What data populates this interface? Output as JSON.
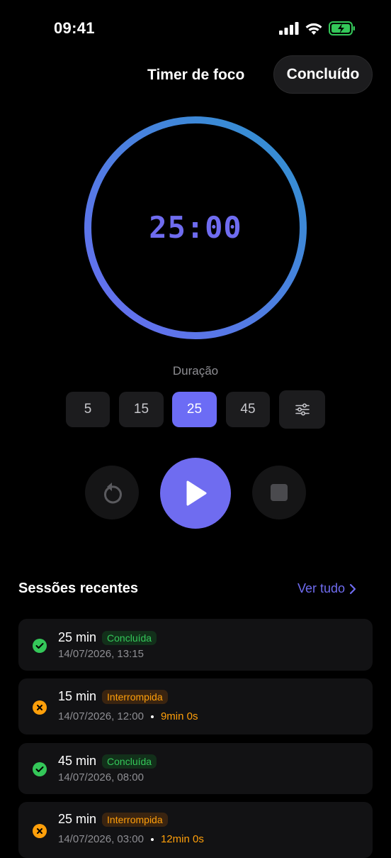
{
  "status_bar": {
    "time": "09:41"
  },
  "header": {
    "title": "Timer de foco",
    "done_label": "Concluído"
  },
  "timer": {
    "display": "25:00",
    "progress": 1.0,
    "gradient_start": "#2f92cf",
    "gradient_end": "#6a6cf2"
  },
  "duration": {
    "label": "Duração",
    "options": [
      "5",
      "15",
      "25",
      "45"
    ],
    "selected": "25"
  },
  "controls": {
    "reset_icon": "reset-icon",
    "play_icon": "play-icon",
    "stop_icon": "stop-icon"
  },
  "recent": {
    "title": "Sessões recentes",
    "see_all": "Ver tudo",
    "sessions": [
      {
        "duration": "25 min",
        "status": "Concluída",
        "kind": "ok",
        "date": "14/07/2026, 13:15",
        "elapsed": ""
      },
      {
        "duration": "15 min",
        "status": "Interrompida",
        "kind": "int",
        "date": "14/07/2026, 12:00",
        "elapsed": "9min 0s"
      },
      {
        "duration": "45 min",
        "status": "Concluída",
        "kind": "ok",
        "date": "14/07/2026, 08:00",
        "elapsed": ""
      },
      {
        "duration": "25 min",
        "status": "Interrompida",
        "kind": "int",
        "date": "14/07/2026, 03:00",
        "elapsed": "12min 0s"
      }
    ]
  },
  "colors": {
    "accent": "#6f6cf0",
    "success": "#34c759",
    "warning": "#ff9f0a"
  }
}
